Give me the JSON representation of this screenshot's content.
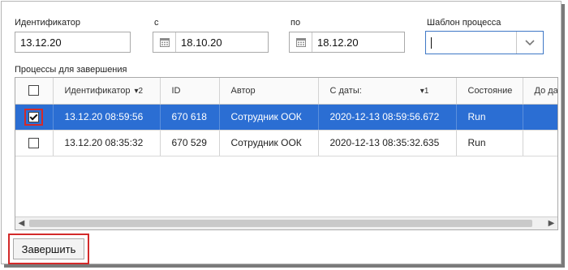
{
  "filters": {
    "identifier": {
      "label": "Идентификатор",
      "value": "13.12.20"
    },
    "from": {
      "label": "с",
      "value": "18.10.20"
    },
    "to": {
      "label": "по",
      "value": "18.12.20"
    },
    "template": {
      "label": "Шаблон процесса",
      "value": ""
    }
  },
  "section_title": "Процессы для завершения",
  "table": {
    "columns": [
      {
        "label": "Идентификатор",
        "sort": "2"
      },
      {
        "label": "ID"
      },
      {
        "label": "Автор"
      },
      {
        "label": "С даты:",
        "sort": "1"
      },
      {
        "label": "Состояние"
      },
      {
        "label": "До даты"
      }
    ],
    "rows": [
      {
        "checked": true,
        "selected": true,
        "identifier": "13.12.20 08:59:56",
        "id": "670 618",
        "author": "Сотрудник ООК",
        "from_date": "2020-12-13 08:59:56.672",
        "state": "Run",
        "to_date": ""
      },
      {
        "checked": false,
        "selected": false,
        "identifier": "13.12.20 08:35:32",
        "id": "670 529",
        "author": "Сотрудник ООК",
        "from_date": "2020-12-13 08:35:32.635",
        "state": "Run",
        "to_date": ""
      }
    ]
  },
  "finish_button": "Завершить",
  "colors": {
    "selection": "#2b6ed3",
    "highlight": "#d32a2a",
    "focus": "#3f78c6"
  },
  "icons": {
    "date": "calendar-icon",
    "dropdown": "chevron-down-icon"
  }
}
